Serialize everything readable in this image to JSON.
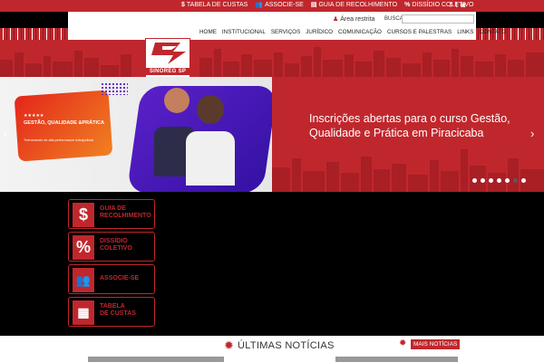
{
  "topbar": {
    "links": [
      {
        "icon": "dollar-icon",
        "glyph": "$",
        "label": "TABELA DE CUSTAS"
      },
      {
        "icon": "users-icon",
        "glyph": "👥",
        "label": "ASSOCIE-SE"
      },
      {
        "icon": "card-icon",
        "glyph": "▤",
        "label": "GUIA DE RECOLHIMENTO"
      },
      {
        "icon": "percent-icon",
        "glyph": "%",
        "label": "DISSÍDIO COLETIVO"
      }
    ],
    "social": [
      "f",
      "t",
      "◙"
    ]
  },
  "header": {
    "restricted_area": "Área restrita",
    "search_label": "BUSCA",
    "search_placeholder": ""
  },
  "nav": [
    "HOME",
    "INSTITUCIONAL",
    "SERVIÇOS",
    "JURÍDICO",
    "COMUNICAÇÃO",
    "CURSOS E PALESTRAS",
    "LINKS",
    "CONTATO"
  ],
  "logo": {
    "text": "SINOREG SP"
  },
  "hero": {
    "card_stars": "★★★★★",
    "card_title": "GESTÃO, QUALIDADE &PRÁTICA",
    "card_small": "Treinamento de alta performance extrajudicial",
    "title": "Inscrições abertas para o curso Gestão, Qualidade e Prática em Piracicaba",
    "dots_total": 7,
    "dots_active": 6,
    "prev": "‹",
    "next": "›"
  },
  "quick_links": [
    {
      "glyph": "$",
      "label1": "GUIA DE",
      "label2": "RECOLHIMENTO"
    },
    {
      "glyph": "%",
      "label1": "DISSÍDIO",
      "label2": "COLETIVO"
    },
    {
      "glyph": "👥",
      "label1": "ASSOCIE-SE",
      "label2": ""
    },
    {
      "glyph": "▦",
      "label1": "TABELA",
      "label2": "DE CUSTAS"
    }
  ],
  "news": {
    "title": "ÚLTIMAS NOTÍCIAS",
    "more": "MAIS NOTÍCIAS"
  },
  "colors": {
    "brand_red": "#c0272d",
    "purple": "#5a20c9"
  }
}
